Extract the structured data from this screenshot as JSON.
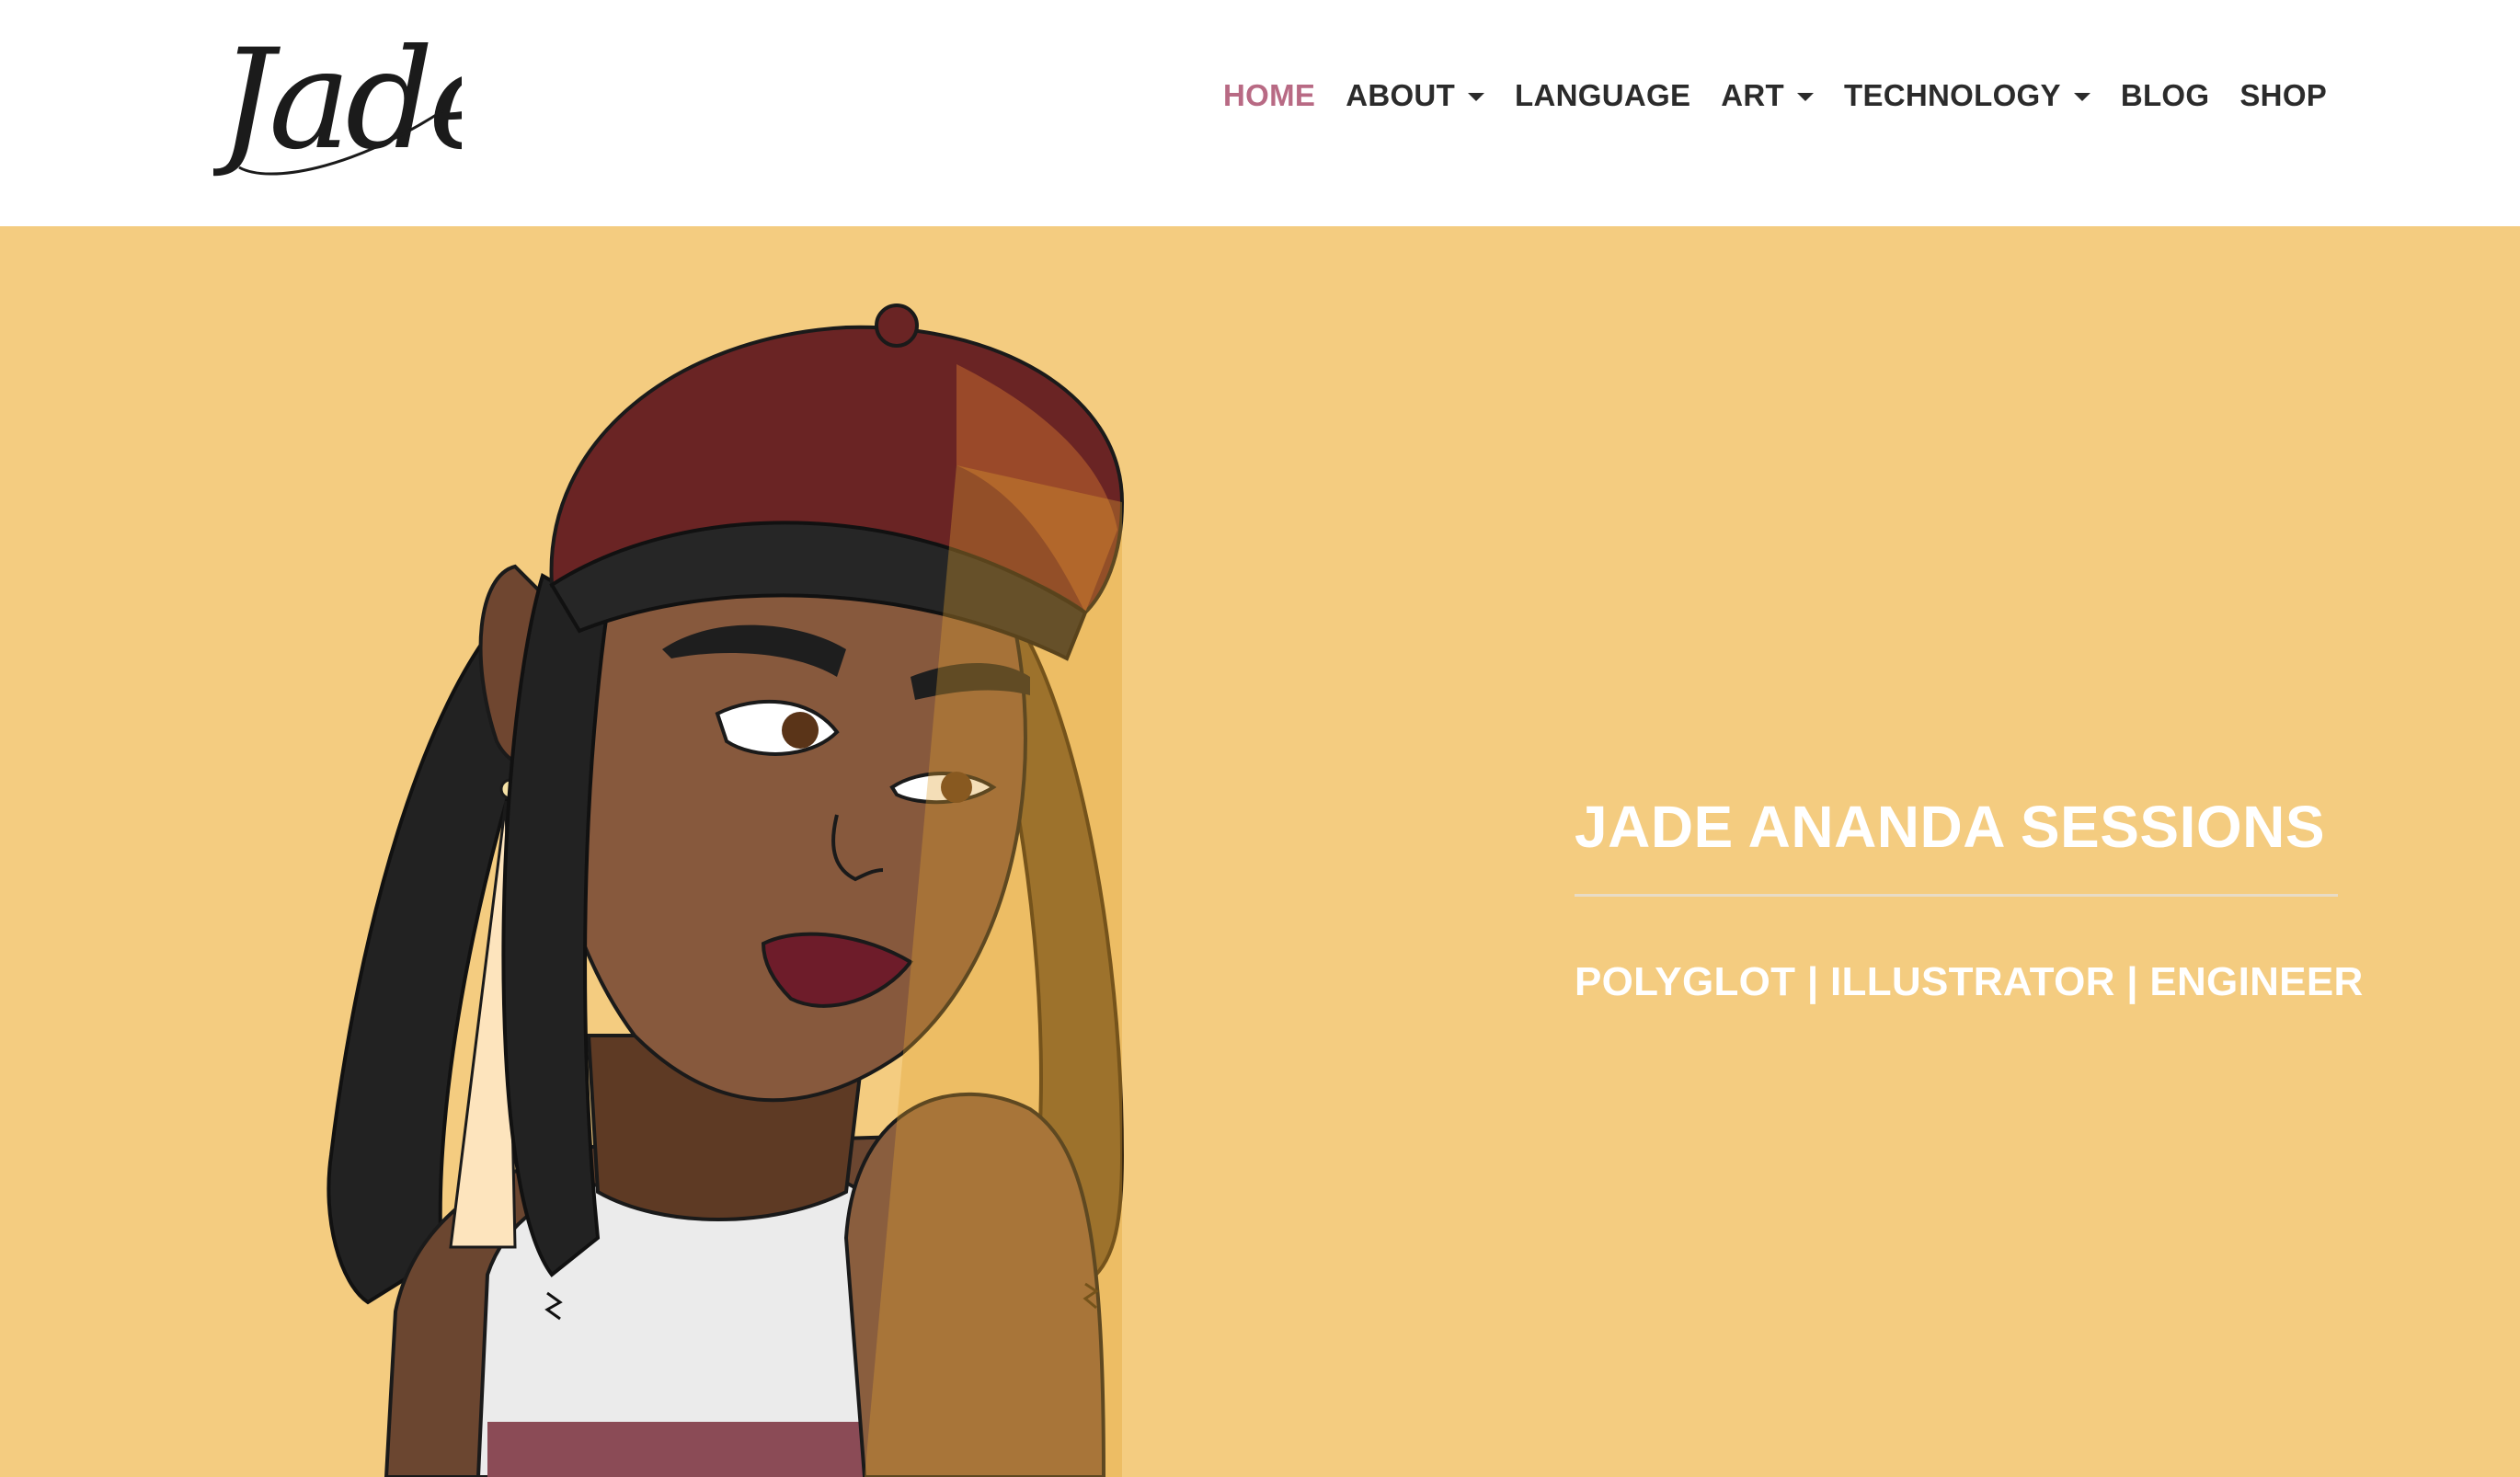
{
  "header": {
    "logo_text": "Jade",
    "nav": [
      {
        "label": "HOME",
        "active": true,
        "dropdown": false
      },
      {
        "label": "ABOUT",
        "active": false,
        "dropdown": true
      },
      {
        "label": "LANGUAGE",
        "active": false,
        "dropdown": false
      },
      {
        "label": "ART",
        "active": false,
        "dropdown": true
      },
      {
        "label": "TECHNOLOGY",
        "active": false,
        "dropdown": true
      },
      {
        "label": "BLOG",
        "active": false,
        "dropdown": false
      },
      {
        "label": "SHOP",
        "active": false,
        "dropdown": false
      }
    ]
  },
  "hero": {
    "title": "JADE ANANDA SESSIONS",
    "subtitle": "POLYGLOT | ILLUSTRATOR | ENGINEER"
  },
  "colors": {
    "hero_background": "#f4cc80",
    "nav_active": "#b86a84",
    "nav_text": "#2b2b2b",
    "hero_text": "#ffffff"
  },
  "icons": {
    "dropdown": "chevron-down-icon"
  }
}
